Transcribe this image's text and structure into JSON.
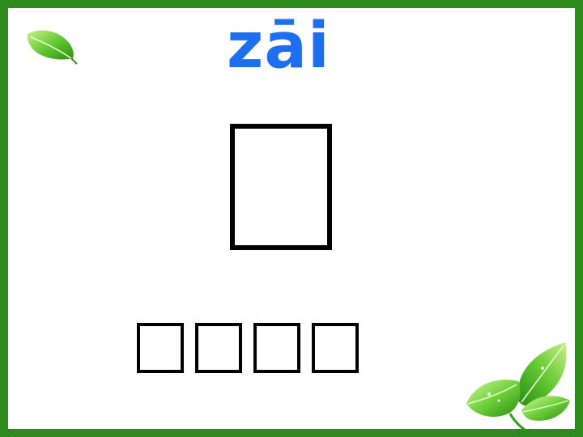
{
  "slide": {
    "pinyin": "zāi",
    "main_character": "",
    "word": [
      "",
      "",
      "",
      ""
    ]
  },
  "icons": {
    "top_left": "leaf-icon",
    "bottom_right": "leaf-cluster-icon"
  },
  "colors": {
    "border": "#2f8a1d",
    "pinyin": "#1e6ff0",
    "leaf_dark": "#2f9e1f",
    "leaf_light": "#9be35c"
  }
}
